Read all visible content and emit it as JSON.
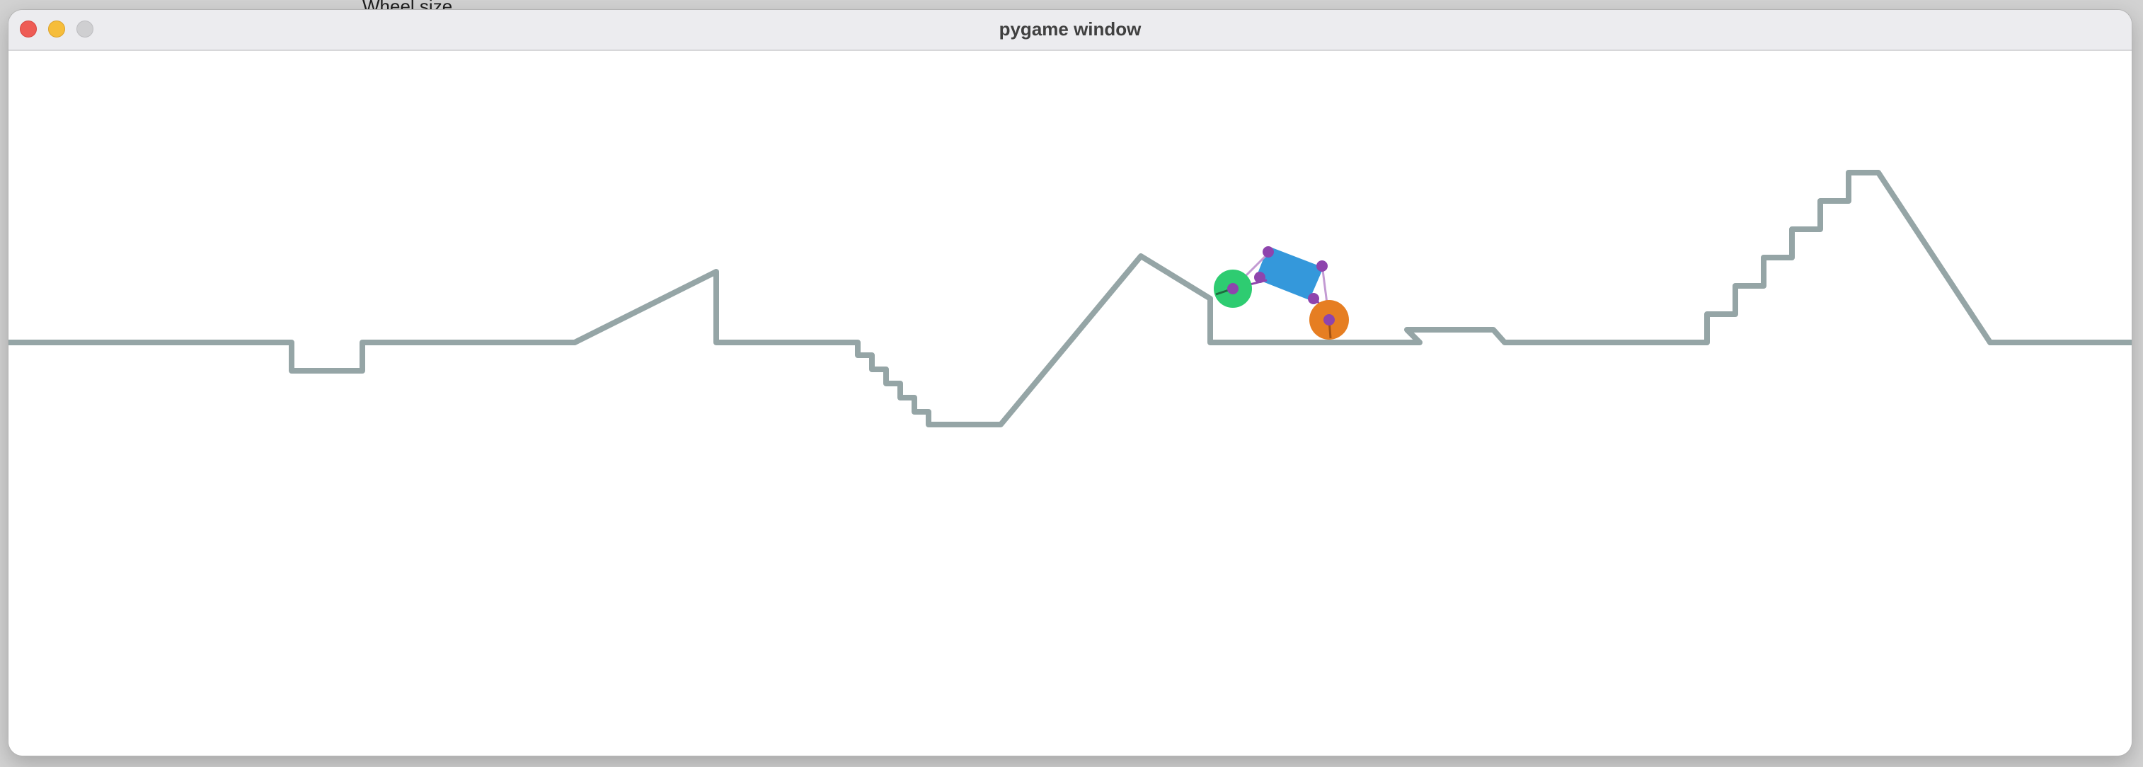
{
  "background_label": "Wheel size",
  "window": {
    "title": "pygame window",
    "buttons": [
      "close",
      "minimize",
      "zoom"
    ]
  },
  "colors": {
    "terrain": "#95a5a6",
    "car_body": "#3498db",
    "front_wheel": "#2ecc71",
    "rear_wheel": "#e67e22",
    "joints": "#8e44ad",
    "window_chrome": "#ececef",
    "canvas": "#ffffff"
  }
}
